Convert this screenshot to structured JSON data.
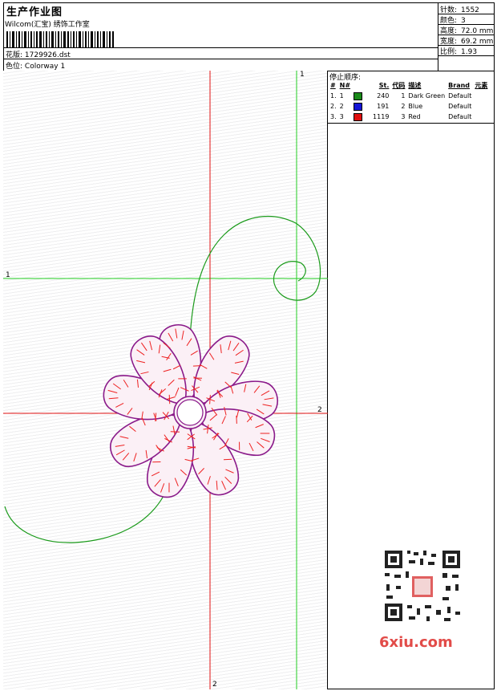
{
  "header": {
    "title": "生产作业图",
    "studio": "Wilcom(汇宝) 绣饰工作室",
    "design_label": "花版:",
    "design_file": "1729926.dst",
    "colorway_label": "色位:",
    "colorway": "Colorway 1"
  },
  "stats": [
    {
      "label": "针数:",
      "value": "1552"
    },
    {
      "label": "颜色:",
      "value": "3"
    },
    {
      "label": "高度:",
      "value": "72.0 mm"
    },
    {
      "label": "宽度:",
      "value": "69.2 mm"
    },
    {
      "label": "比例:",
      "value": "1.93"
    }
  ],
  "stop_sequence": {
    "title": "停止顺序:",
    "columns": [
      "#",
      "N#",
      "St.",
      "代码",
      "描述",
      "Brand",
      "元素"
    ],
    "rows": [
      {
        "num": "1.",
        "n": "1",
        "color": "#1a8a1a",
        "st": "240",
        "code": "1",
        "desc": "Dark Green",
        "brand": "Default"
      },
      {
        "num": "2.",
        "n": "2",
        "color": "#1515d6",
        "st": "191",
        "code": "2",
        "desc": "Blue",
        "brand": "Default"
      },
      {
        "num": "3.",
        "n": "3",
        "color": "#e01010",
        "st": "1119",
        "code": "3",
        "desc": "Red",
        "brand": "Default"
      }
    ]
  },
  "axis_labels": {
    "green_v": "1",
    "green_h": "1",
    "red_h": "2",
    "red_v": "2"
  },
  "watermark": "6xiu.com",
  "colors": {
    "green_guide": "#22cc22",
    "red_guide": "#e01010",
    "petal_outline": "#8a1a8a",
    "stitch_red": "#ee2020"
  }
}
